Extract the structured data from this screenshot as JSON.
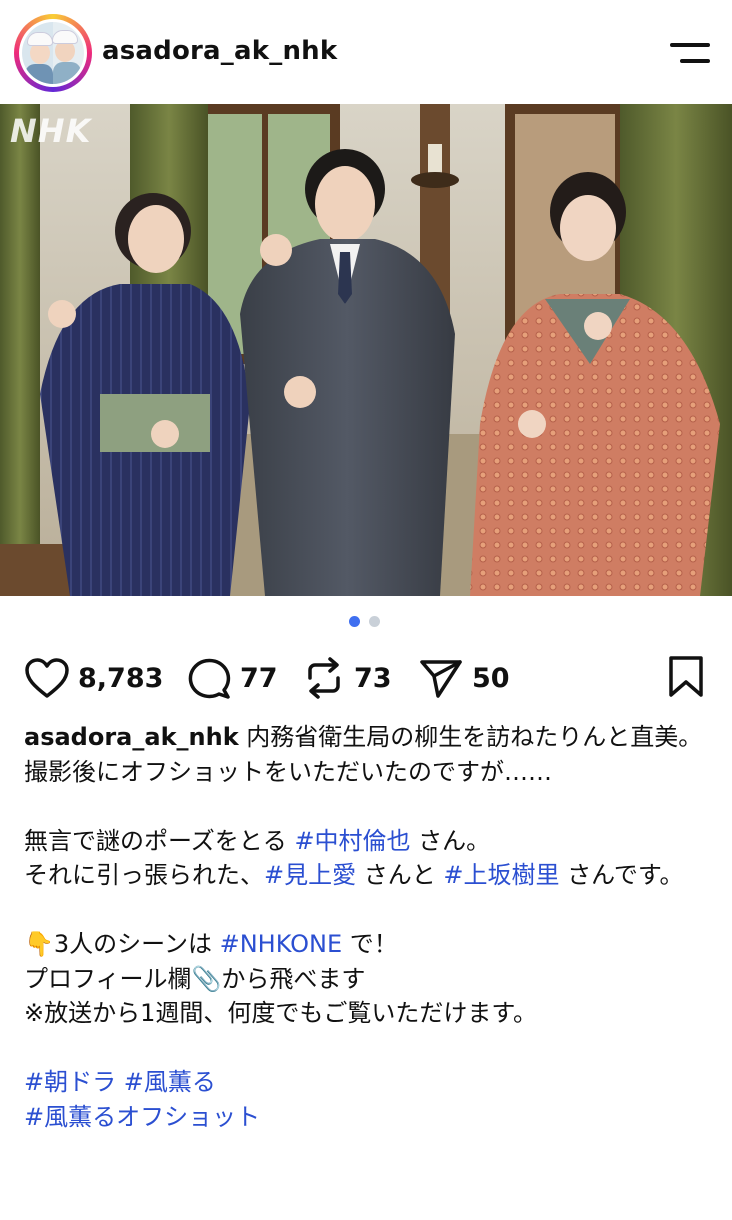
{
  "header": {
    "username": "asadora_ak_nhk",
    "avatar_icon": "profile-avatar-two-nurses"
  },
  "photo": {
    "watermark": "NHK",
    "carousel": {
      "current": 1,
      "total": 2
    }
  },
  "actions": {
    "likes": "8,783",
    "comments": "77",
    "reposts": "73",
    "shares": "50"
  },
  "caption": {
    "username": "asadora_ak_nhk",
    "line1": " 内務省衛生局の柳生を訪ねたりんと直美。",
    "line2": "撮影後にオフショットをいただいたのですが……",
    "line3_pre": "無言で謎のポーズをとる ",
    "tag_nakamura": "#中村倫也",
    "line3_post": " さん。",
    "line4_pre": "それに引っ張られた、",
    "tag_mikami": "#見上愛",
    "line4_mid": " さんと ",
    "tag_kamisaka": "#上坂樹里",
    "line4_post": " さんです。",
    "line5_emoji": "👇",
    "line5_pre": "3人のシーンは ",
    "tag_nhkone": "#NHKONE",
    "line5_post": " で！",
    "line6_pre": "プロフィール欄",
    "line6_emoji": "📎",
    "line6_post": "から飛べます",
    "line7": "※放送から1週間、何度でもご覧いただけます。",
    "tag_asadora": "#朝ドラ",
    "tag_kaoru": "#風薫る",
    "tag_offshot": "#風薫るオフショット"
  },
  "colors": {
    "hashtag": "#2b4fd1",
    "pager_active": "#3f6ff0",
    "pager_inactive": "#c9d0d8"
  }
}
